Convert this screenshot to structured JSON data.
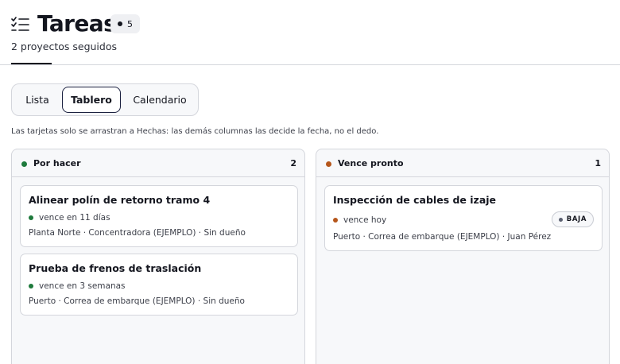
{
  "header": {
    "title": "Tareas",
    "count": "5",
    "subtitle": "2 proyectos seguidos",
    "icon": "checklist-icon"
  },
  "view_tabs": {
    "items": [
      "Lista",
      "Tablero",
      "Calendario"
    ],
    "active": "Tablero"
  },
  "hint": "Las tarjetas solo se arrastran a Hechas: las demás columnas las decide la fecha, no el dedo.",
  "colors": {
    "todo": "#1e7a3c",
    "due_soon": "#b5561b",
    "priority_low": "#5a5f70",
    "accent": "#1b2140"
  },
  "columns": [
    {
      "title": "Por hacer",
      "count": "2",
      "cards": [
        {
          "title": "Alinear polín de retorno tramo 4",
          "due": "vence en 11 días",
          "meta": "Planta Norte · Concentradora (EJEMPLO) · Sin dueño"
        },
        {
          "title": "Prueba de frenos de traslación",
          "due": "vence en 3 semanas",
          "meta": "Puerto · Correa de embarque (EJEMPLO) · Sin dueño"
        }
      ]
    },
    {
      "title": "Vence pronto",
      "count": "1",
      "cards": [
        {
          "title": "Inspección de cables de izaje",
          "due": "vence hoy",
          "meta": "Puerto · Correa de embarque (EJEMPLO) · Juan Pérez",
          "priority": "BAJA"
        }
      ]
    }
  ]
}
